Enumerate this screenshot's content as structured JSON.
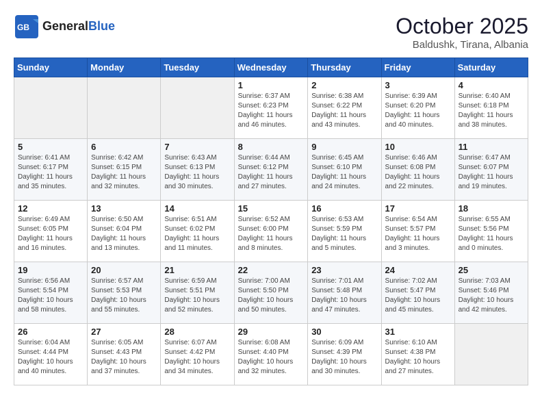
{
  "header": {
    "logo_general": "General",
    "logo_blue": "Blue",
    "month": "October 2025",
    "location": "Baldushk, Tirana, Albania"
  },
  "weekdays": [
    "Sunday",
    "Monday",
    "Tuesday",
    "Wednesday",
    "Thursday",
    "Friday",
    "Saturday"
  ],
  "weeks": [
    [
      {
        "day": "",
        "info": ""
      },
      {
        "day": "",
        "info": ""
      },
      {
        "day": "",
        "info": ""
      },
      {
        "day": "1",
        "info": "Sunrise: 6:37 AM\nSunset: 6:23 PM\nDaylight: 11 hours\nand 46 minutes."
      },
      {
        "day": "2",
        "info": "Sunrise: 6:38 AM\nSunset: 6:22 PM\nDaylight: 11 hours\nand 43 minutes."
      },
      {
        "day": "3",
        "info": "Sunrise: 6:39 AM\nSunset: 6:20 PM\nDaylight: 11 hours\nand 40 minutes."
      },
      {
        "day": "4",
        "info": "Sunrise: 6:40 AM\nSunset: 6:18 PM\nDaylight: 11 hours\nand 38 minutes."
      }
    ],
    [
      {
        "day": "5",
        "info": "Sunrise: 6:41 AM\nSunset: 6:17 PM\nDaylight: 11 hours\nand 35 minutes."
      },
      {
        "day": "6",
        "info": "Sunrise: 6:42 AM\nSunset: 6:15 PM\nDaylight: 11 hours\nand 32 minutes."
      },
      {
        "day": "7",
        "info": "Sunrise: 6:43 AM\nSunset: 6:13 PM\nDaylight: 11 hours\nand 30 minutes."
      },
      {
        "day": "8",
        "info": "Sunrise: 6:44 AM\nSunset: 6:12 PM\nDaylight: 11 hours\nand 27 minutes."
      },
      {
        "day": "9",
        "info": "Sunrise: 6:45 AM\nSunset: 6:10 PM\nDaylight: 11 hours\nand 24 minutes."
      },
      {
        "day": "10",
        "info": "Sunrise: 6:46 AM\nSunset: 6:08 PM\nDaylight: 11 hours\nand 22 minutes."
      },
      {
        "day": "11",
        "info": "Sunrise: 6:47 AM\nSunset: 6:07 PM\nDaylight: 11 hours\nand 19 minutes."
      }
    ],
    [
      {
        "day": "12",
        "info": "Sunrise: 6:49 AM\nSunset: 6:05 PM\nDaylight: 11 hours\nand 16 minutes."
      },
      {
        "day": "13",
        "info": "Sunrise: 6:50 AM\nSunset: 6:04 PM\nDaylight: 11 hours\nand 13 minutes."
      },
      {
        "day": "14",
        "info": "Sunrise: 6:51 AM\nSunset: 6:02 PM\nDaylight: 11 hours\nand 11 minutes."
      },
      {
        "day": "15",
        "info": "Sunrise: 6:52 AM\nSunset: 6:00 PM\nDaylight: 11 hours\nand 8 minutes."
      },
      {
        "day": "16",
        "info": "Sunrise: 6:53 AM\nSunset: 5:59 PM\nDaylight: 11 hours\nand 5 minutes."
      },
      {
        "day": "17",
        "info": "Sunrise: 6:54 AM\nSunset: 5:57 PM\nDaylight: 11 hours\nand 3 minutes."
      },
      {
        "day": "18",
        "info": "Sunrise: 6:55 AM\nSunset: 5:56 PM\nDaylight: 11 hours\nand 0 minutes."
      }
    ],
    [
      {
        "day": "19",
        "info": "Sunrise: 6:56 AM\nSunset: 5:54 PM\nDaylight: 10 hours\nand 58 minutes."
      },
      {
        "day": "20",
        "info": "Sunrise: 6:57 AM\nSunset: 5:53 PM\nDaylight: 10 hours\nand 55 minutes."
      },
      {
        "day": "21",
        "info": "Sunrise: 6:59 AM\nSunset: 5:51 PM\nDaylight: 10 hours\nand 52 minutes."
      },
      {
        "day": "22",
        "info": "Sunrise: 7:00 AM\nSunset: 5:50 PM\nDaylight: 10 hours\nand 50 minutes."
      },
      {
        "day": "23",
        "info": "Sunrise: 7:01 AM\nSunset: 5:48 PM\nDaylight: 10 hours\nand 47 minutes."
      },
      {
        "day": "24",
        "info": "Sunrise: 7:02 AM\nSunset: 5:47 PM\nDaylight: 10 hours\nand 45 minutes."
      },
      {
        "day": "25",
        "info": "Sunrise: 7:03 AM\nSunset: 5:46 PM\nDaylight: 10 hours\nand 42 minutes."
      }
    ],
    [
      {
        "day": "26",
        "info": "Sunrise: 6:04 AM\nSunset: 4:44 PM\nDaylight: 10 hours\nand 40 minutes."
      },
      {
        "day": "27",
        "info": "Sunrise: 6:05 AM\nSunset: 4:43 PM\nDaylight: 10 hours\nand 37 minutes."
      },
      {
        "day": "28",
        "info": "Sunrise: 6:07 AM\nSunset: 4:42 PM\nDaylight: 10 hours\nand 34 minutes."
      },
      {
        "day": "29",
        "info": "Sunrise: 6:08 AM\nSunset: 4:40 PM\nDaylight: 10 hours\nand 32 minutes."
      },
      {
        "day": "30",
        "info": "Sunrise: 6:09 AM\nSunset: 4:39 PM\nDaylight: 10 hours\nand 30 minutes."
      },
      {
        "day": "31",
        "info": "Sunrise: 6:10 AM\nSunset: 4:38 PM\nDaylight: 10 hours\nand 27 minutes."
      },
      {
        "day": "",
        "info": ""
      }
    ]
  ]
}
